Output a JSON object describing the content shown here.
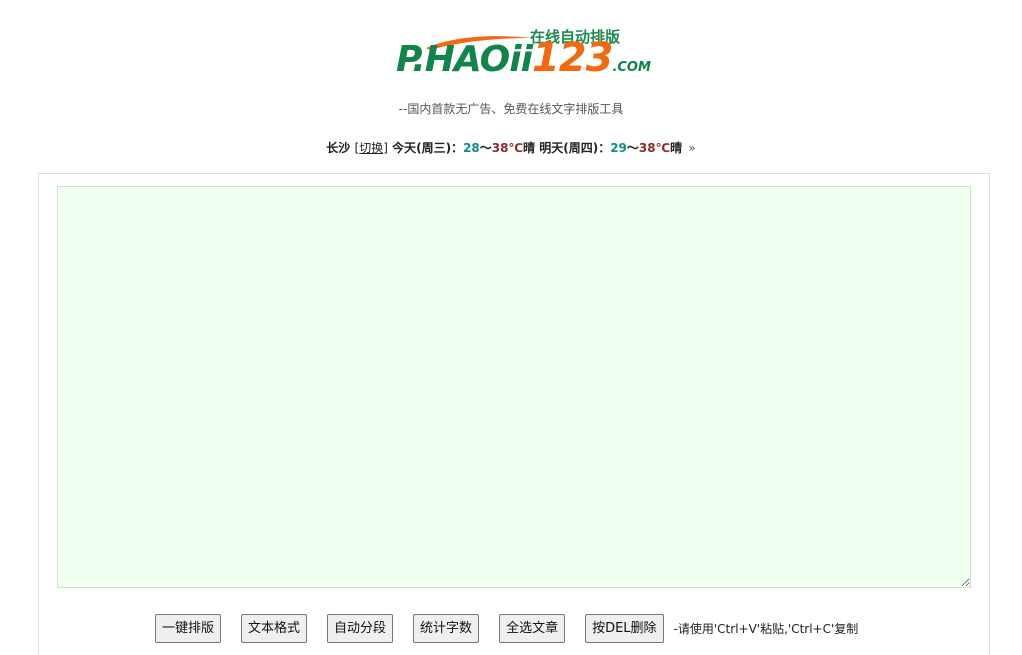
{
  "logo": {
    "tagline": "在线自动排版",
    "brand_green": "P.HAOii",
    "brand_orange": "123",
    "brand_suffix": ".COM",
    "colors": {
      "green": "#10844a",
      "orange": "#f06a12"
    }
  },
  "subtitle": "--国内首款无广告、免费在线文字排版工具",
  "weather": {
    "city": "长沙",
    "switch_open": "[",
    "switch_label": "切换",
    "switch_close": "]",
    "today_label": "今天(周三)：",
    "today_low": "28",
    "today_sep": "～",
    "today_high": "38℃",
    "today_cond": "晴",
    "tomorrow_label": "明天(周四)：",
    "tomorrow_low": "29",
    "tomorrow_sep": "～",
    "tomorrow_high": "38℃",
    "tomorrow_cond": "晴",
    "more_icon": "»"
  },
  "editor": {
    "value": "",
    "placeholder": ""
  },
  "toolbar": {
    "buttons": [
      {
        "label": "一键排版"
      },
      {
        "label": "文本格式"
      },
      {
        "label": "自动分段"
      },
      {
        "label": "统计字数"
      },
      {
        "label": "全选文章"
      },
      {
        "label": "按DEL删除"
      }
    ],
    "hint": "-请使用'Ctrl+V'粘贴,'Ctrl+C'复制"
  }
}
